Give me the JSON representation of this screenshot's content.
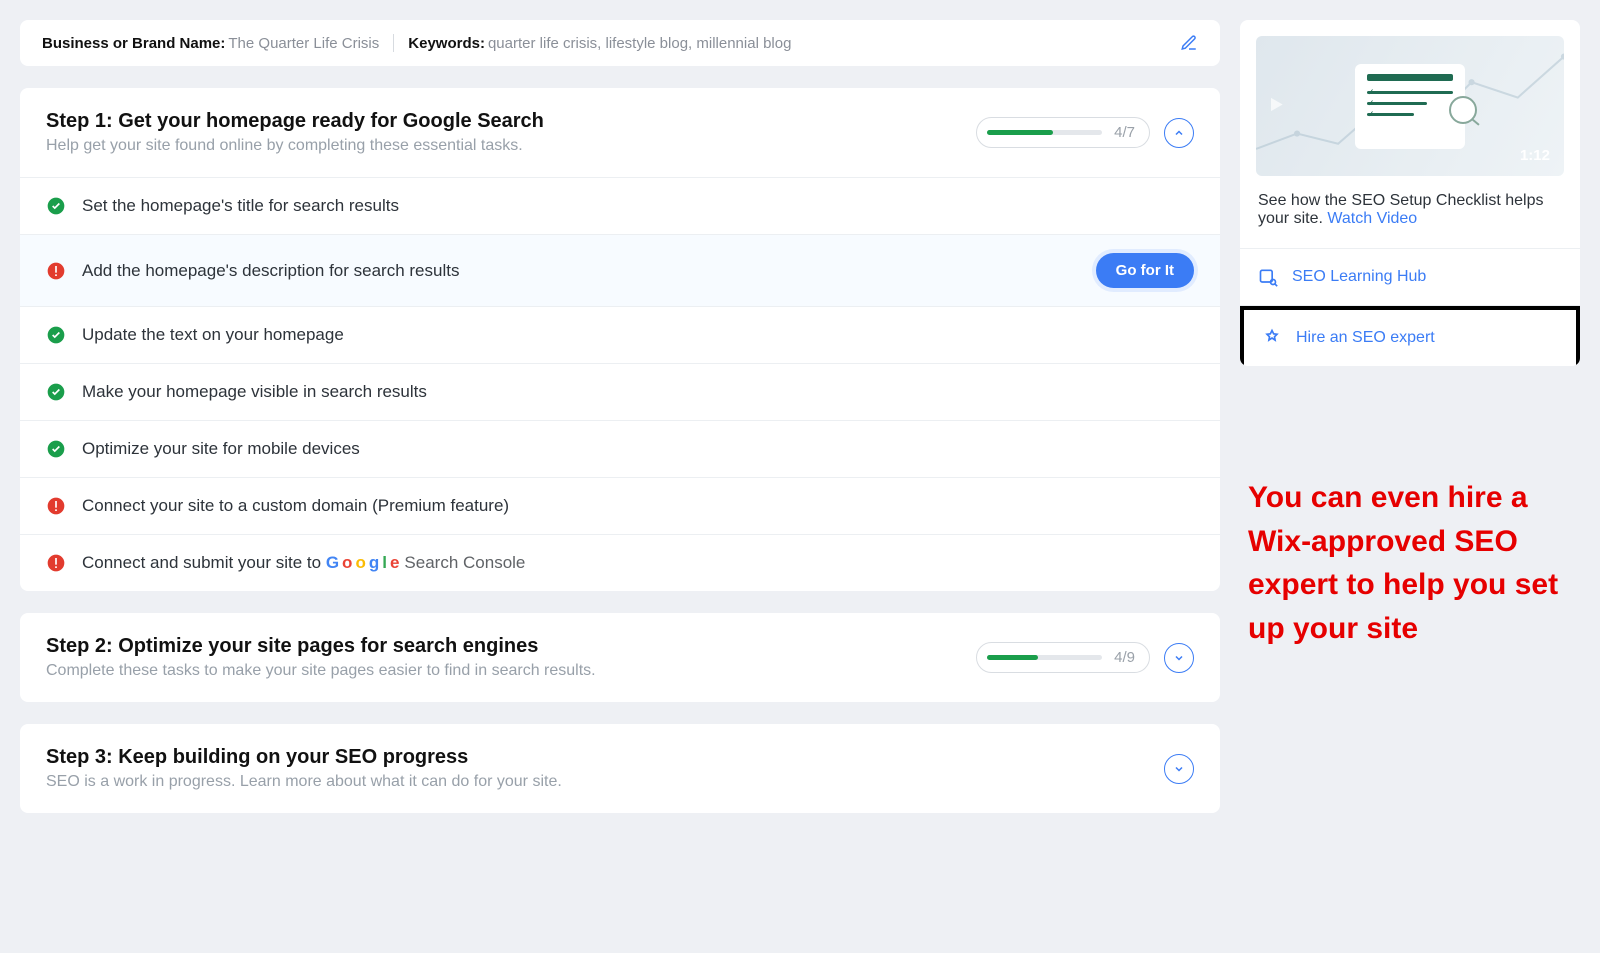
{
  "header": {
    "brand_label": "Business or Brand Name:",
    "brand_value": "The Quarter Life Crisis",
    "keywords_label": "Keywords:",
    "keywords_value": "quarter life crisis, lifestyle blog, millennial blog"
  },
  "steps": {
    "step1": {
      "title": "Step 1: Get your homepage ready for Google Search",
      "subtitle": "Help get your site found online by completing these essential tasks.",
      "progress_text": "4/7",
      "progress_percent": 57,
      "tasks": [
        {
          "status": "done",
          "label": "Set the homepage's title for search results"
        },
        {
          "status": "warn",
          "label": "Add the homepage's description for search results",
          "cta": "Go for It",
          "highlight": true
        },
        {
          "status": "done",
          "label": "Update the text on your homepage"
        },
        {
          "status": "done",
          "label": "Make your homepage visible in search results"
        },
        {
          "status": "done",
          "label": "Optimize your site for mobile devices"
        },
        {
          "status": "warn",
          "label": "Connect your site to a custom domain (Premium feature)"
        },
        {
          "status": "warn",
          "label_prefix": "Connect and submit your site to",
          "gsc_suffix": "Search Console"
        }
      ]
    },
    "step2": {
      "title": "Step 2: Optimize your site pages for search engines",
      "subtitle": "Complete these tasks to make your site pages easier to find in search results.",
      "progress_text": "4/9",
      "progress_percent": 44
    },
    "step3": {
      "title": "Step 3: Keep building on your SEO progress",
      "subtitle": "SEO is a work in progress. Learn more about what it can do for your site."
    }
  },
  "sidebar": {
    "video_time": "1:12",
    "video_caption": "See how the SEO Setup Checklist helps your site.",
    "watch_link": "Watch Video",
    "learning_hub": "SEO Learning Hub",
    "hire_expert": "Hire an SEO expert"
  },
  "annotation": {
    "text": "You can even hire a Wix-approved SEO expert to help you set up your site"
  }
}
